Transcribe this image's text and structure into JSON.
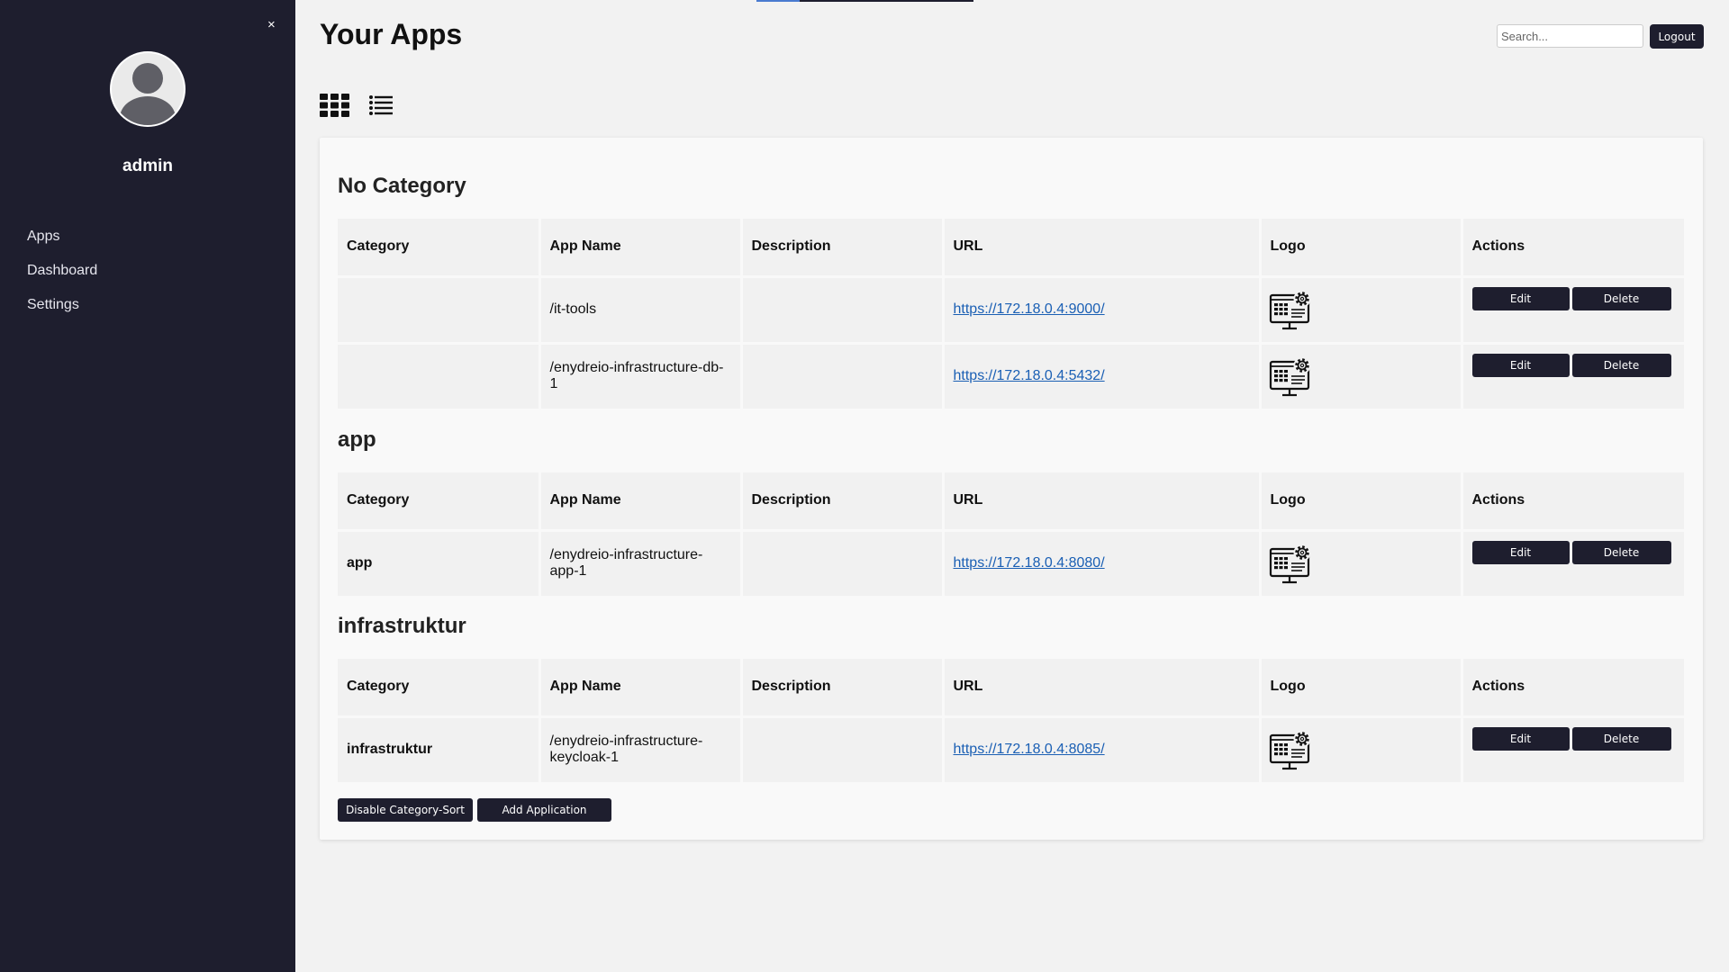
{
  "sidebar": {
    "close_label": "×",
    "username": "admin",
    "nav": [
      {
        "label": "Apps"
      },
      {
        "label": "Dashboard"
      },
      {
        "label": "Settings"
      }
    ]
  },
  "header": {
    "title": "Your Apps",
    "search_placeholder": "Search...",
    "logout_label": "Logout"
  },
  "columns": [
    "Category",
    "App Name",
    "Description",
    "URL",
    "Logo",
    "Actions"
  ],
  "actions": {
    "edit": "Edit",
    "delete": "Delete"
  },
  "sections": [
    {
      "heading": "No Category",
      "rows": [
        {
          "category": "",
          "app_name": "/it-tools",
          "description": "",
          "url": "https://172.18.0.4:9000/"
        },
        {
          "category": "",
          "app_name": "/enydreio-infrastructure-db-1",
          "description": "",
          "url": "https://172.18.0.4:5432/"
        }
      ]
    },
    {
      "heading": "app",
      "rows": [
        {
          "category": "app",
          "app_name": "/enydreio-infrastructure-app-1",
          "description": "",
          "url": "https://172.18.0.4:8080/"
        }
      ]
    },
    {
      "heading": "infrastruktur",
      "rows": [
        {
          "category": "infrastruktur",
          "app_name": "/enydreio-infrastructure-keycloak-1",
          "description": "",
          "url": "https://172.18.0.4:8085/"
        }
      ]
    }
  ],
  "footer": {
    "disable_sort_label": "Disable Category-Sort",
    "add_app_label": "Add Application"
  },
  "colors": {
    "sidebar_bg": "#1e1e2e",
    "button_bg": "#1e1e2e",
    "link": "#1a5fb4",
    "page_bg": "#f2f2f2"
  }
}
